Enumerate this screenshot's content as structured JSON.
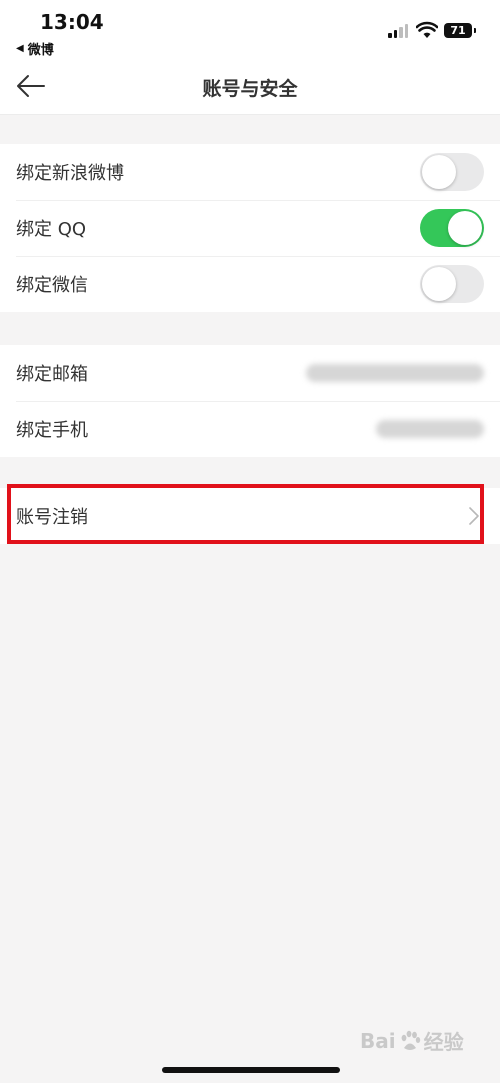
{
  "status_bar": {
    "time": "13:04",
    "back_app_label": "微博",
    "battery_level": "71"
  },
  "nav": {
    "title": "账号与安全"
  },
  "bindings": {
    "weibo": {
      "label": "绑定新浪微博",
      "enabled": false
    },
    "qq": {
      "label": "绑定 QQ",
      "enabled": true
    },
    "wechat": {
      "label": "绑定微信",
      "enabled": false
    }
  },
  "contacts": {
    "email": {
      "label": "绑定邮箱"
    },
    "phone": {
      "label": "绑定手机"
    }
  },
  "account": {
    "deactivate_label": "账号注销"
  },
  "watermark": {
    "text_a": "Bai",
    "text_b": "经验"
  },
  "colors": {
    "accent_toggle_on": "#34c759",
    "highlight_border": "#e1111a",
    "background": "#f5f4f4"
  }
}
